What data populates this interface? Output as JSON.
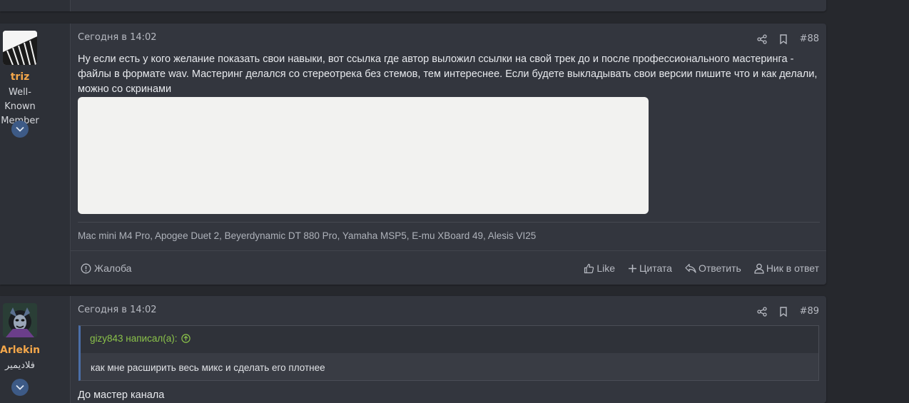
{
  "posts": [
    {
      "username": "triz",
      "user_title": "Well-Known Member",
      "date": "Сегодня в 14:02",
      "number": "#88",
      "body": "Ну если есть у кого желание показать свои навыки, вот ссылка где автор выложил ссылки на свой трек до и после профессионального мастеринга - файлы в формате wav. Мастеринг делался со стереотрека без стемов, тем интереснее. Если будете выкладывать свои версии пишите что и как делали, можно со скринами",
      "signature": "Mac mini M4 Pro, Apogee Duet 2, Beyerdynamic DT 880 Pro, Yamaha MSP5, E-mu XBoard 49, Alesis VI25",
      "footer": {
        "report": "Жалоба",
        "like": "Like",
        "quote": "Цитата",
        "reply": "Ответить",
        "nick": "Ник в ответ"
      }
    },
    {
      "username": "Arlekin",
      "user_title": "فلاديمير",
      "date": "Сегодня в 14:02",
      "number": "#89",
      "quote_author": "gizy843 написал(а):",
      "quote_text": "как мне расширить весь микс и сделать его плотнее",
      "body_partial": "До мастер канала"
    }
  ],
  "colors": {
    "background": "#26282d",
    "post": "#33363e",
    "username": "#f4a74a",
    "quote_author": "#8bc34a",
    "accent": "#3d5a86"
  }
}
